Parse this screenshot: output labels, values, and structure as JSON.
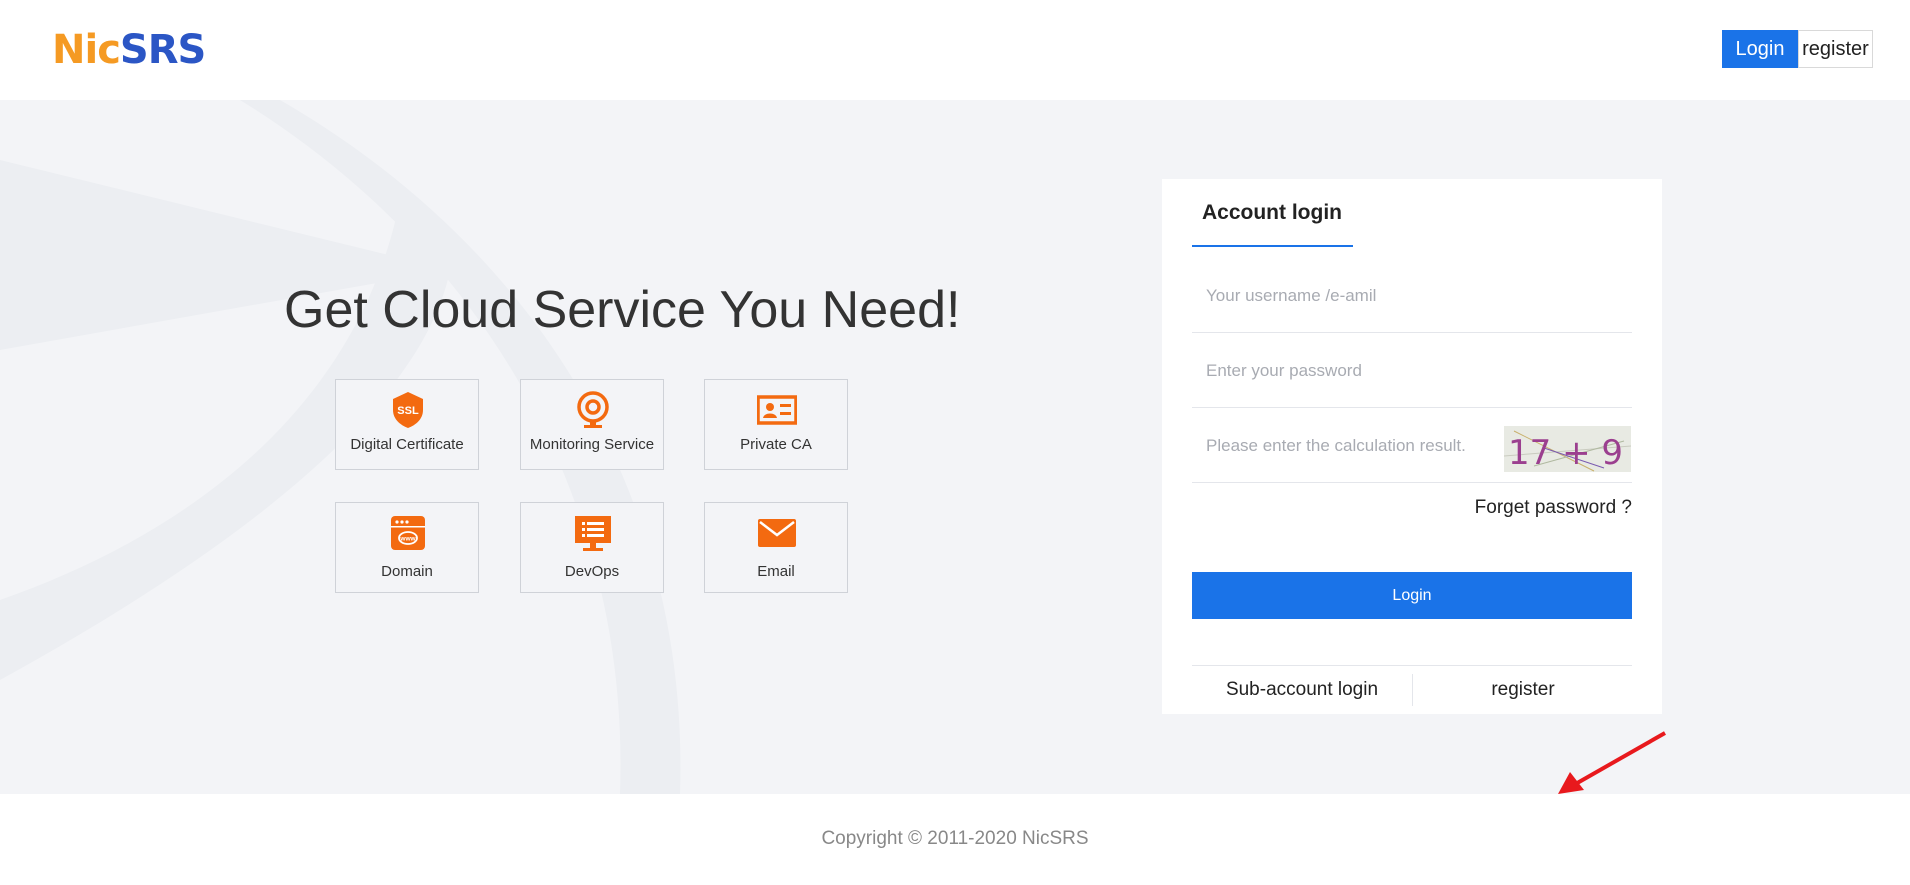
{
  "header": {
    "logo_part1": "Nic",
    "logo_part2": "SRS",
    "login_label": "Login",
    "register_label": "register"
  },
  "hero": {
    "headline": "Get Cloud Service You Need!",
    "services": [
      {
        "label": "Digital Certificate",
        "icon": "ssl-shield-icon"
      },
      {
        "label": "Monitoring Service",
        "icon": "monitor-camera-icon"
      },
      {
        "label": "Private CA",
        "icon": "id-card-icon"
      },
      {
        "label": "Domain",
        "icon": "www-browser-icon"
      },
      {
        "label": "DevOps",
        "icon": "devops-screen-icon"
      },
      {
        "label": "Email",
        "icon": "envelope-icon"
      }
    ],
    "ssl_badge_text": "SSL",
    "www_badge_text": "www"
  },
  "login": {
    "tab_title": "Account login",
    "username_placeholder": "Your username /e-amil",
    "password_placeholder": "Enter your password",
    "captcha_placeholder": "Please enter the calculation result.",
    "captcha_text": "17 + 9 =",
    "forgot_label": "Forget password ?",
    "login_button": "Login",
    "sub_account_label": "Sub-account login",
    "register_label": "register"
  },
  "footer": {
    "copyright": "Copyright © 2011-2020 NicSRS"
  },
  "colors": {
    "primary": "#1a73e8",
    "accent_orange": "#f36a10",
    "logo_orange": "#f59a23",
    "logo_blue": "#2b56c5",
    "arrow_red": "#e8191d",
    "hero_bg": "#f3f4f7"
  }
}
